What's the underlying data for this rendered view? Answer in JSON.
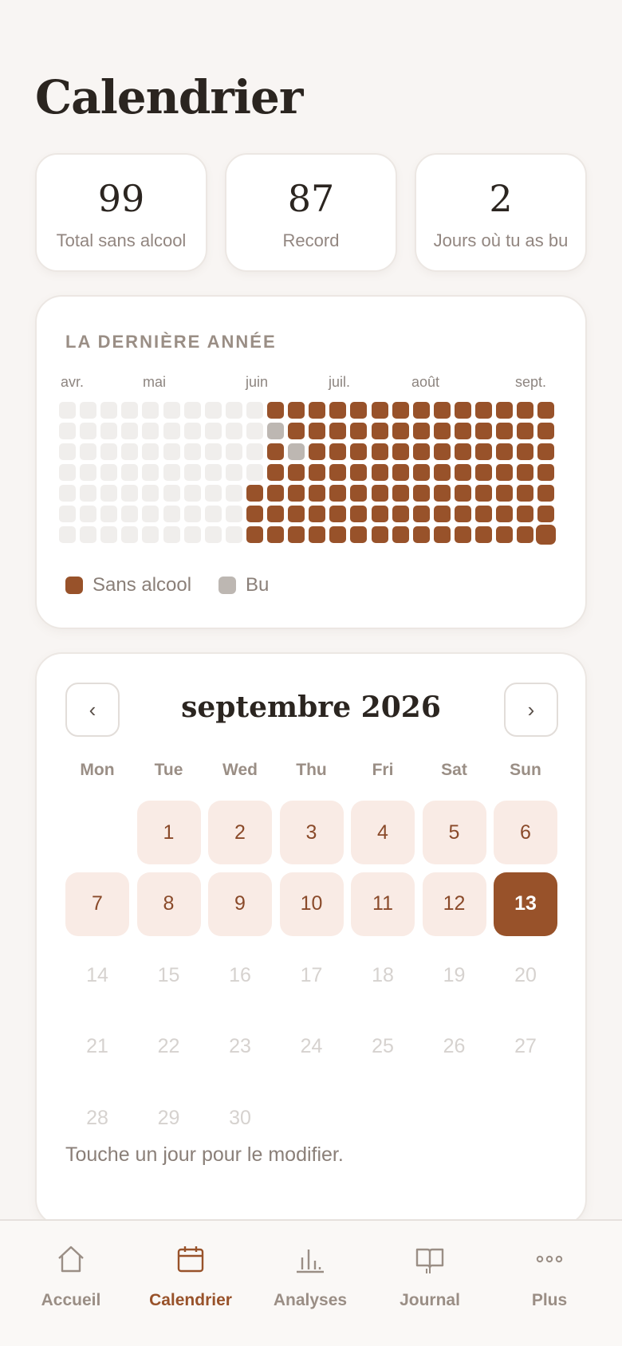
{
  "page": {
    "title": "Calendrier"
  },
  "stats": [
    {
      "value": "99",
      "label": "Total sans alcool"
    },
    {
      "value": "87",
      "label": "Record"
    },
    {
      "value": "2",
      "label": "Jours où tu as bu"
    }
  ],
  "year_section": {
    "title": "LA DERNIÈRE ANNÉE",
    "months": [
      "avr.",
      "mai",
      "juin",
      "juil.",
      "août",
      "sept."
    ],
    "legend": {
      "sober": "Sans alcool",
      "drank": "Bu"
    },
    "weeks": 24,
    "days_per_week": 7,
    "colors": {
      "sober": "#98522a",
      "drank": "#bdb7b2",
      "empty": "#f0eeec"
    },
    "heatmap_status": "Each column is a week (Mon→Sun). '.' = no data, 's' = sans alcool, 'b' = bu, 'T' = today",
    "columns": [
      ".......",
      ".......",
      ".......",
      ".......",
      ".......",
      ".......",
      ".......",
      ".......",
      ".......",
      "....sss",
      "sbssss s",
      "ssbssss",
      "sssssss",
      "sssssss",
      "sssssss",
      "sssssss",
      "sssssss",
      "sssssss",
      "sssssss",
      "sssssss",
      "sssssss",
      "sssssss",
      "sssssss",
      "ssssssT"
    ]
  },
  "calendar": {
    "month_label": "septembre 2026",
    "prev_label": "‹",
    "next_label": "›",
    "weekdays": [
      "Mon",
      "Tue",
      "Wed",
      "Thu",
      "Fri",
      "Sat",
      "Sun"
    ],
    "first_weekday_index": 1,
    "days_in_month": 30,
    "today": 13,
    "hint": "Touche un jour pour le modifier."
  },
  "tabs": [
    {
      "label": "Accueil",
      "icon": "home-icon",
      "active": false
    },
    {
      "label": "Calendrier",
      "icon": "calendar-icon",
      "active": true
    },
    {
      "label": "Analyses",
      "icon": "chart-icon",
      "active": false
    },
    {
      "label": "Journal",
      "icon": "book-icon",
      "active": false
    },
    {
      "label": "Plus",
      "icon": "more-icon",
      "active": false
    }
  ],
  "colors": {
    "accent": "#98522a",
    "accent_light": "#f9ebe5",
    "muted": "#9a8e85",
    "background": "#f8f5f3"
  }
}
